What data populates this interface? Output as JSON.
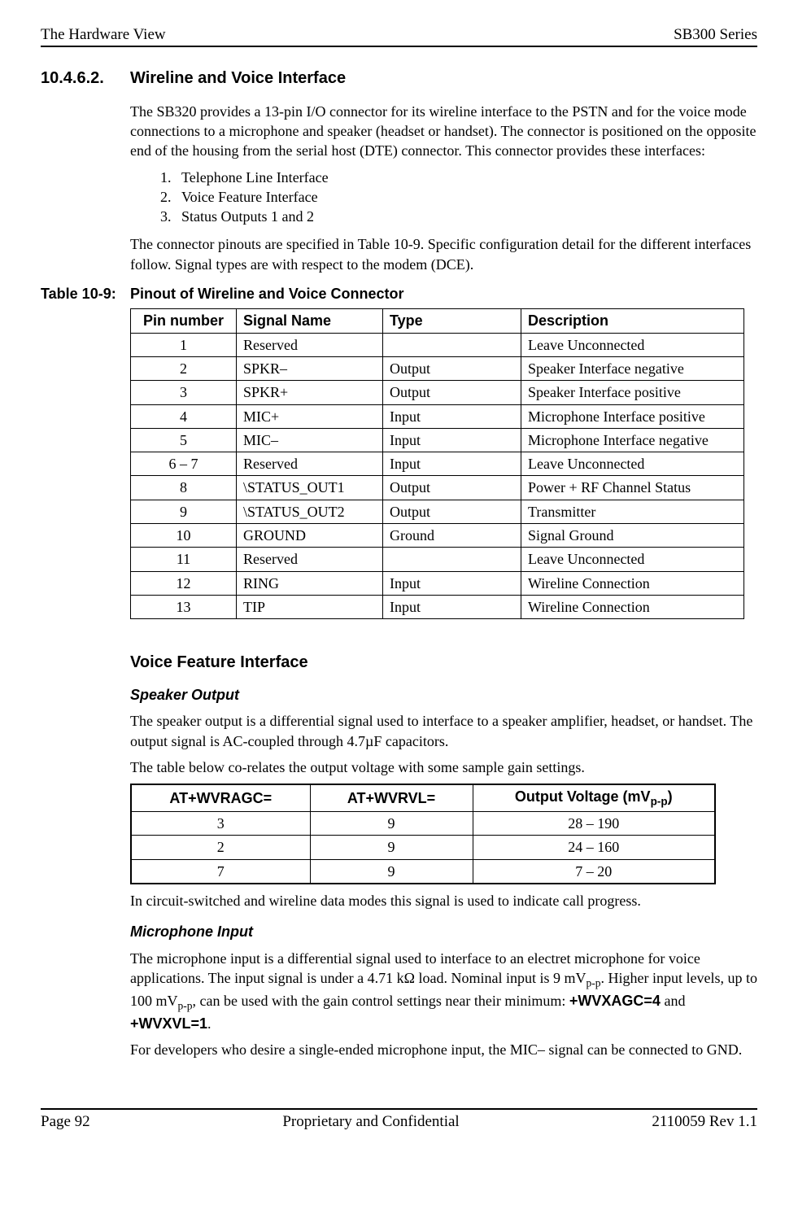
{
  "header": {
    "left": "The Hardware View",
    "right": "SB300 Series"
  },
  "section": {
    "number": "10.4.6.2.",
    "title": "Wireline and Voice Interface",
    "intro": "The SB320 provides a 13-pin I/O connector for its wireline interface to the PSTN and for the voice mode connections to a microphone and speaker (headset or handset).  The connector is positioned on the opposite end of the housing from the serial host (DTE) connector.  This connector provides these interfaces:",
    "list": [
      "Telephone Line Interface",
      "Voice Feature Interface",
      "Status Outputs 1 and 2"
    ],
    "post_list": "The connector pinouts are specified in Table 10-9.  Specific configuration detail for the different interfaces follow.  Signal types are with respect to the modem (DCE)."
  },
  "table109": {
    "label": "Table 10-9:",
    "title": "Pinout of Wireline and Voice Connector",
    "headers": [
      "Pin number",
      "Signal Name",
      "Type",
      "Description"
    ],
    "rows": [
      [
        "1",
        "Reserved",
        "",
        "Leave Unconnected"
      ],
      [
        "2",
        "SPKR–",
        "Output",
        "Speaker Interface negative"
      ],
      [
        "3",
        "SPKR+",
        "Output",
        "Speaker Interface positive"
      ],
      [
        "4",
        "MIC+",
        "Input",
        "Microphone Interface positive"
      ],
      [
        "5",
        "MIC–",
        "Input",
        "Microphone Interface negative"
      ],
      [
        "6 – 7",
        "Reserved",
        "Input",
        "Leave Unconnected"
      ],
      [
        "8",
        "\\STATUS_OUT1",
        "Output",
        "Power + RF Channel Status"
      ],
      [
        "9",
        "\\STATUS_OUT2",
        "Output",
        "Transmitter"
      ],
      [
        "10",
        "GROUND",
        "Ground",
        "Signal Ground"
      ],
      [
        "11",
        "Reserved",
        "",
        "Leave Unconnected"
      ],
      [
        "12",
        "RING",
        "Input",
        "Wireline Connection"
      ],
      [
        "13",
        "TIP",
        "Input",
        "Wireline Connection"
      ]
    ]
  },
  "voice": {
    "heading": "Voice Feature Interface",
    "speaker_h": "Speaker Output",
    "speaker_p1": "The speaker output is a differential signal used to interface to a speaker amplifier, headset, or handset.  The output signal is AC-coupled through 4.7µF capacitors.",
    "speaker_p2": "The table below co-relates the output voltage with some sample gain settings.",
    "vtable": {
      "h1": "AT+WVRAGC=",
      "h2": "AT+WVRVL=",
      "h3_pre": "Output Voltage (mV",
      "h3_sub": "p-p",
      "h3_post": ")",
      "rows": [
        [
          "3",
          "9",
          "28 – 190"
        ],
        [
          "2",
          "9",
          "24 – 160"
        ],
        [
          "7",
          "9",
          "7 – 20"
        ]
      ]
    },
    "speaker_p3": "In circuit-switched and wireline data modes this signal is used to indicate call progress.",
    "mic_h": "Microphone Input",
    "mic_p1_a": "The microphone input is a differential signal used to interface to an electret microphone for voice applications.  The input signal is under a 4.71 kΩ load.  Nominal input is 9 mV",
    "mic_p1_sub1": "p-p",
    "mic_p1_b": ".  Higher input levels, up to 100 mV",
    "mic_p1_sub2": "p-p",
    "mic_p1_c": ", can be used with the gain control settings near their minimum: ",
    "mic_bold1": "+WVXAGC=4",
    "mic_and": " and ",
    "mic_bold2": "+WVXVL=1",
    "mic_period": ".",
    "mic_p2": "For developers who desire a single-ended microphone input, the MIC– signal can be connected to GND."
  },
  "footer": {
    "left": "Page 92",
    "center": "Proprietary and Confidential",
    "right": "2110059 Rev 1.1"
  }
}
